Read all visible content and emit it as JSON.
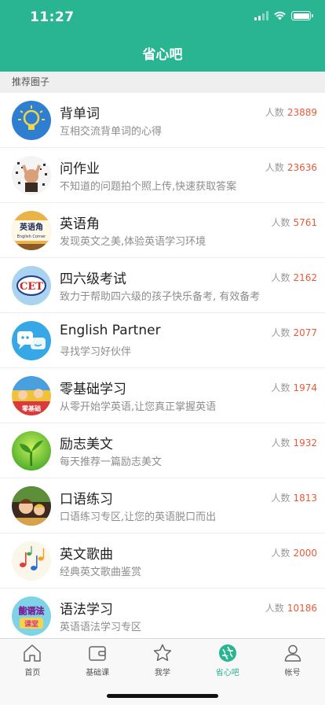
{
  "status": {
    "time": "11:27"
  },
  "nav": {
    "title": "省心吧"
  },
  "section": {
    "title": "推荐圈子"
  },
  "count_label": "人数",
  "groups": [
    {
      "title": "背单词",
      "desc": "互相交流背单词的心得",
      "count": "23889",
      "icon": "lightbulb-icon"
    },
    {
      "title": "问作业",
      "desc": "不知道的问题拍个照上传,快速获取答案",
      "count": "23636",
      "icon": "raised-hands-icon"
    },
    {
      "title": "英语角",
      "desc": "发现英文之美,体验英语学习环境",
      "count": "5761",
      "icon": "english-corner-sign-icon"
    },
    {
      "title": "四六级考试",
      "desc": "致力于帮助四六级的孩子快乐备考, 有效备考",
      "count": "2162",
      "icon": "cet-badge-icon"
    },
    {
      "title": "English Partner",
      "desc": "寻找学习好伙伴",
      "count": "2077",
      "icon": "chat-bubbles-icon"
    },
    {
      "title": "零基础学习",
      "desc": "从零开始学英语,让您真正掌握英语",
      "count": "1974",
      "icon": "cartoon-class-icon"
    },
    {
      "title": "励志美文",
      "desc": "每天推荐一篇励志美文",
      "count": "1932",
      "icon": "sprout-icon"
    },
    {
      "title": "口语练习",
      "desc": "口语练习专区,让您的英语脱口而出",
      "count": "1813",
      "icon": "speaking-kids-icon"
    },
    {
      "title": "英文歌曲",
      "desc": "经典英文歌曲鉴赏",
      "count": "2000",
      "icon": "music-notes-icon"
    },
    {
      "title": "语法学习",
      "desc": "英语语法学习专区",
      "count": "10186",
      "icon": "grammar-class-icon"
    }
  ],
  "icon_texts": {
    "english_corner": "英语角",
    "english_corner_sub": "English Corner",
    "cet": "CET",
    "grammar": "能语法",
    "grammar_sub": "课堂",
    "zero": "零基础"
  },
  "tabs": [
    {
      "label": "首页",
      "icon": "home-icon"
    },
    {
      "label": "基础课",
      "icon": "wallet-icon"
    },
    {
      "label": "我学",
      "icon": "star-icon"
    },
    {
      "label": "省心吧",
      "icon": "aperture-icon",
      "active": true
    },
    {
      "label": "帐号",
      "icon": "person-icon"
    }
  ],
  "colors": {
    "brand": "#29b591",
    "count": "#e85b3a"
  }
}
